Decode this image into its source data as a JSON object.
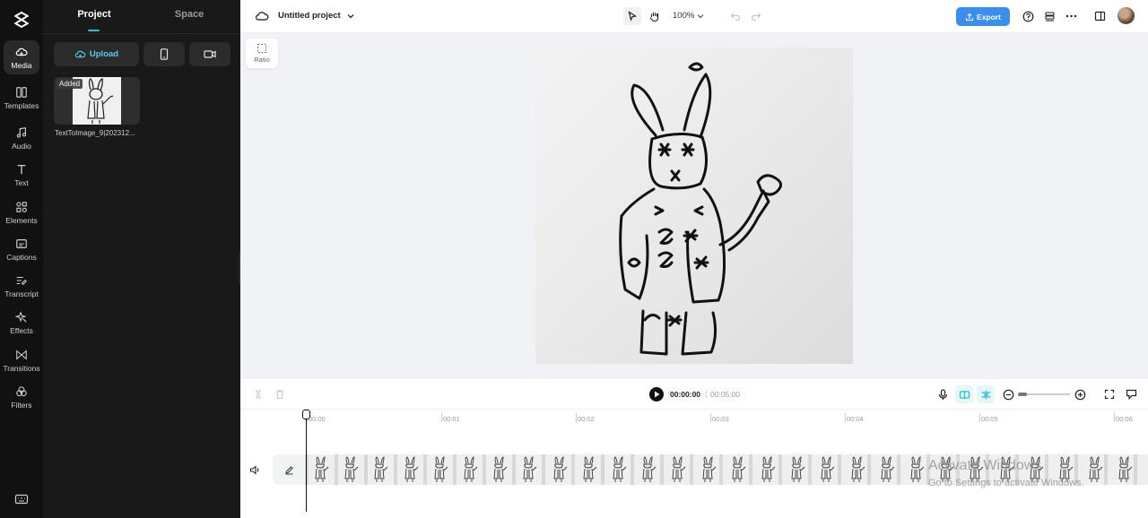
{
  "rail": {
    "items": [
      {
        "label": "Media",
        "icon": "media-cloud-icon"
      },
      {
        "label": "Templates",
        "icon": "templates-icon"
      },
      {
        "label": "Audio",
        "icon": "music-note-icon"
      },
      {
        "label": "Text",
        "icon": "text-icon"
      },
      {
        "label": "Elements",
        "icon": "elements-icon"
      },
      {
        "label": "Captions",
        "icon": "captions-icon"
      },
      {
        "label": "Transcript",
        "icon": "transcript-icon"
      },
      {
        "label": "Effects",
        "icon": "effects-icon"
      },
      {
        "label": "Transitions",
        "icon": "transitions-icon"
      },
      {
        "label": "Filters",
        "icon": "filters-icon"
      }
    ]
  },
  "panel": {
    "tabs": [
      {
        "label": "Project"
      },
      {
        "label": "Space"
      }
    ],
    "upload_label": "Upload",
    "media": [
      {
        "badge": "Added",
        "name": "TextToImage_9|202312..."
      }
    ]
  },
  "topbar": {
    "project_title": "Untitled project",
    "zoom": "100%",
    "export_label": "Export"
  },
  "canvas": {
    "ratio_label": "Ratio"
  },
  "player": {
    "current_time": "00:00:00",
    "separator": "|",
    "total_time": "00:05:00"
  },
  "timeline": {
    "ruler": [
      "00:00",
      "00:01",
      "00:02",
      "00:03",
      "00:04",
      "00:05",
      "00:06"
    ]
  },
  "watermark": {
    "line1": "Activate Windows",
    "line2": "Go to Settings to activate Windows."
  },
  "colors": {
    "accent": "#21c1d8",
    "export": "#3a8ef0"
  }
}
